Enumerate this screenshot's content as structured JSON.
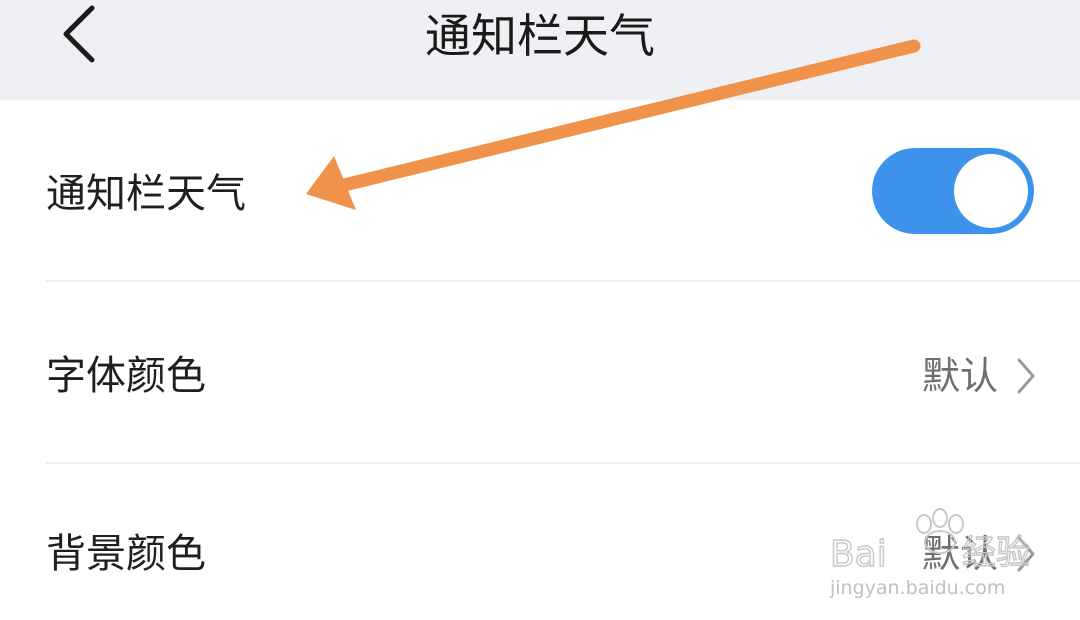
{
  "header": {
    "back_icon": "chevron-left-icon",
    "title": "通知栏天气"
  },
  "settings": {
    "notification_weather": {
      "label": "通知栏天气",
      "enabled": true
    },
    "font_color": {
      "label": "字体颜色",
      "value": "默认",
      "icon": "chevron-right-icon"
    },
    "background_color": {
      "label": "背景颜色",
      "value": "默认",
      "icon": "chevron-right-icon"
    }
  },
  "annotation": {
    "icon": "arrow-icon",
    "color": "#f0924a"
  },
  "watermark": {
    "logo": "Baidu经验",
    "url": "jingyan.baidu.com"
  },
  "colors": {
    "header_bg": "#eff0f4",
    "toggle_on": "#3d93ec",
    "divider": "#ececec"
  }
}
